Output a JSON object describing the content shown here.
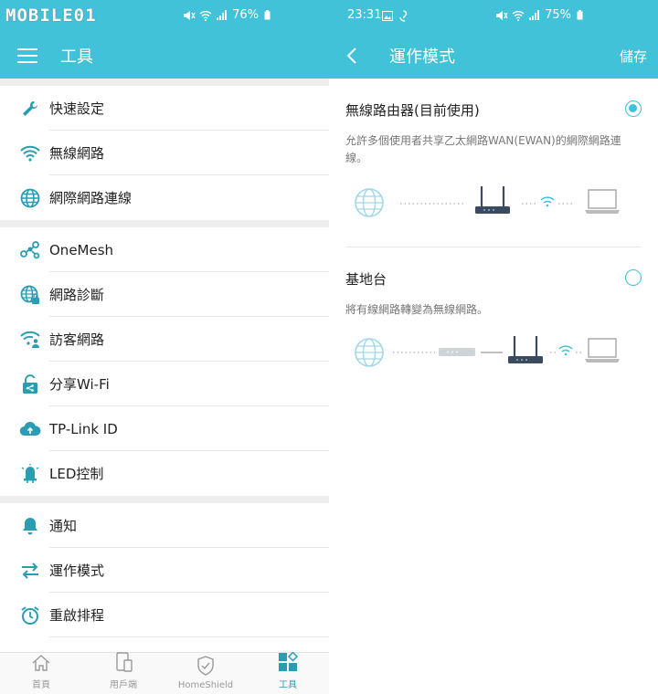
{
  "left": {
    "status": {
      "watermark": "MOBILE01",
      "battery": "76%"
    },
    "header": {
      "title": "工具"
    },
    "groups": [
      [
        {
          "name": "quick-setup",
          "label": "快速設定",
          "icon": "wrench-icon"
        },
        {
          "name": "wireless",
          "label": "無線網路",
          "icon": "wifi-icon"
        },
        {
          "name": "internet",
          "label": "網際網路連線",
          "icon": "globe-icon"
        }
      ],
      [
        {
          "name": "onemesh",
          "label": "OneMesh",
          "icon": "mesh-icon"
        },
        {
          "name": "diagnostics",
          "label": "網路診斷",
          "icon": "globe-lock-icon"
        },
        {
          "name": "guest",
          "label": "訪客網路",
          "icon": "guest-wifi-icon"
        },
        {
          "name": "share-wifi",
          "label": "分享Wi-Fi",
          "icon": "share-lock-icon"
        },
        {
          "name": "tplink-id",
          "label": "TP-Link ID",
          "icon": "cloud-icon"
        },
        {
          "name": "led",
          "label": "LED控制",
          "icon": "led-icon"
        }
      ],
      [
        {
          "name": "notifications",
          "label": "通知",
          "icon": "bell-icon"
        },
        {
          "name": "operation-mode",
          "label": "運作模式",
          "icon": "swap-icon"
        },
        {
          "name": "reboot-schedule",
          "label": "重啟排程",
          "icon": "alarm-icon"
        }
      ]
    ],
    "tabs": [
      {
        "name": "home",
        "label": "首頁",
        "icon": "home-icon",
        "active": false
      },
      {
        "name": "clients",
        "label": "用戶端",
        "icon": "devices-icon",
        "active": false
      },
      {
        "name": "homeshield",
        "label": "HomeShield",
        "icon": "shield-icon",
        "active": false
      },
      {
        "name": "tools",
        "label": "工具",
        "icon": "tools-icon",
        "active": true
      }
    ]
  },
  "right": {
    "status": {
      "time": "23:31",
      "battery": "75%"
    },
    "header": {
      "title": "運作模式",
      "save_label": "儲存"
    },
    "modes": [
      {
        "name": "router",
        "title": "無線路由器(目前使用)",
        "desc": "允許多個使用者共享乙太網路WAN(EWAN)的網際網路連線。",
        "selected": true
      },
      {
        "name": "access-point",
        "title": "基地台",
        "desc": "將有線網路轉變為無線網路。",
        "selected": false
      }
    ]
  },
  "colors": {
    "accent": "#41c2d8",
    "icon": "#2a9db3"
  }
}
